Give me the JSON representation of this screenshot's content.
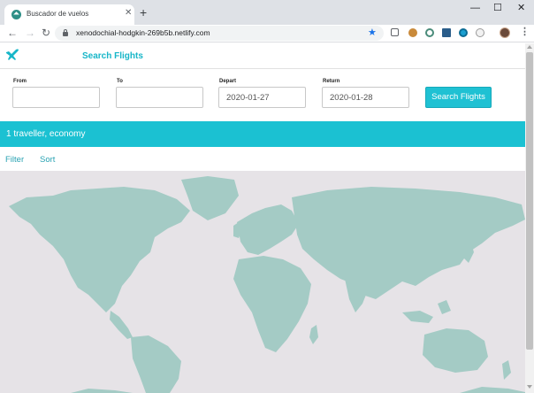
{
  "browser": {
    "tab_title": "Buscador de vuelos",
    "tab_close": "✕",
    "new_tab": "+",
    "url": "xenodochial-hodgkin-269b5b.netlify.com",
    "window_minimize": "—",
    "window_maximize": "☐",
    "window_close": "✕",
    "back": "←",
    "forward": "→",
    "reload": "↻",
    "star": "★",
    "menu": "⋮",
    "extensions": [
      "puzzle-icon",
      "cookie-icon",
      "eye-icon",
      "color-picker-icon",
      "circle-icon",
      "sheep-icon"
    ],
    "colors": {
      "tabbar": "#dee1e6",
      "accent": "#1a73e8"
    }
  },
  "header": {
    "logo": "plane-icon",
    "title": "Search Flights"
  },
  "search": {
    "from_label": "From",
    "from_value": "",
    "to_label": "To",
    "to_value": "",
    "depart_label": "Depart",
    "depart_value": "2020-01-27",
    "return_label": "Return",
    "return_value": "2020-01-28",
    "submit_label": "Search Flights"
  },
  "summary": {
    "text": "1 traveller, economy"
  },
  "actions": {
    "filter": "Filter",
    "sort": "Sort"
  },
  "theme": {
    "brand": "#1bc1d2",
    "map_land": "#a4cbc5",
    "map_water": "#e6e3e7"
  }
}
